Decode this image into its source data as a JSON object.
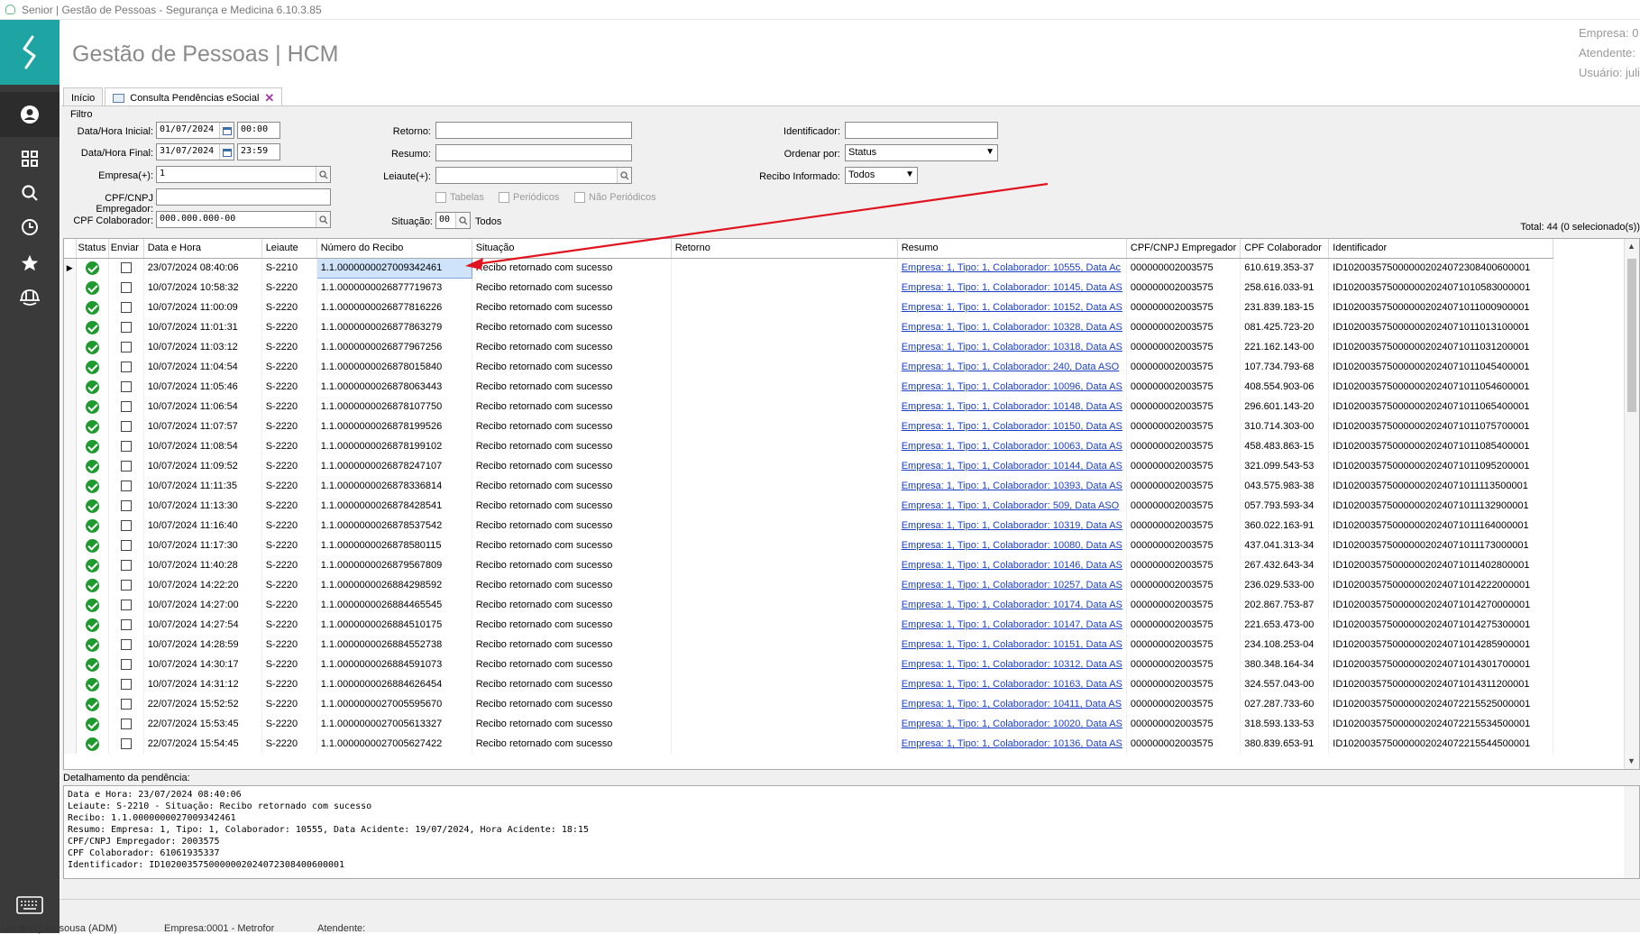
{
  "window": {
    "title": "Senior | Gestão de Pessoas - Segurança e Medicina 6.10.3.85"
  },
  "header": {
    "app_title": "Gestão de Pessoas | HCM",
    "empresa_label": "Empresa: 0",
    "atendente_label": "Atendente:",
    "usuario_label": "Usuário: juli"
  },
  "tabs": [
    {
      "label": "Início"
    },
    {
      "label": "Consulta Pendências eSocial"
    }
  ],
  "filter": {
    "section_label": "Filtro",
    "data_hora_inicial_label": "Data/Hora Inicial:",
    "data_inicial": "01/07/2024",
    "hora_inicial": "00:00",
    "data_hora_final_label": "Data/Hora Final:",
    "data_final": "31/07/2024",
    "hora_final": "23:59",
    "empresa_label": "Empresa(+):",
    "empresa_value": "1",
    "cpf_cnpj_empregador_label": "CPF/CNPJ Empregador:",
    "cpf_cnpj_empregador_value": "",
    "cpf_colaborador_label": "CPF Colaborador:",
    "cpf_colaborador_value": "000.000.000-00",
    "retorno_label": "Retorno:",
    "resumo_label": "Resumo:",
    "leiaute_label": "Leiaute(+):",
    "tabelas_label": "Tabelas",
    "periodicos_label": "Periódicos",
    "nao_periodicos_label": "Não Periódicos",
    "situacao_label": "Situação:",
    "situacao_value": "00",
    "situacao_desc": "Todos",
    "identificador_label": "Identificador:",
    "ordenar_por_label": "Ordenar por:",
    "ordenar_por_value": "Status",
    "recibo_informado_label": "Recibo Informado:",
    "recibo_informado_value": "Todos",
    "total_text": "Total: 44 (0 selecionado(s))"
  },
  "grid": {
    "columns": [
      "Status",
      "Enviar",
      "Data e Hora",
      "Leiaute",
      "Número do Recibo",
      "Situação",
      "Retorno",
      "Resumo",
      "CPF/CNPJ Empregador",
      "CPF Colaborador",
      "Identificador"
    ],
    "rows": [
      {
        "data": "23/07/2024 08:40:06",
        "leiaute": "S-2210",
        "recibo": "1.1.0000000027009342461",
        "situacao": "Recibo retornado com sucesso",
        "resumo": "Empresa: 1, Tipo: 1, Colaborador: 10555, Data Ac",
        "empregador": "000000002003575",
        "cpf": "610.619.353-37",
        "id": "ID1020035750000002024072308400600001"
      },
      {
        "data": "10/07/2024 10:58:32",
        "leiaute": "S-2220",
        "recibo": "1.1.0000000026877719673",
        "situacao": "Recibo retornado com sucesso",
        "resumo": "Empresa: 1, Tipo: 1, Colaborador: 10145, Data AS",
        "empregador": "000000002003575",
        "cpf": "258.616.033-91",
        "id": "ID1020035750000002024071010583000001"
      },
      {
        "data": "10/07/2024 11:00:09",
        "leiaute": "S-2220",
        "recibo": "1.1.0000000026877816226",
        "situacao": "Recibo retornado com sucesso",
        "resumo": "Empresa: 1, Tipo: 1, Colaborador: 10152, Data AS",
        "empregador": "000000002003575",
        "cpf": "231.839.183-15",
        "id": "ID1020035750000002024071011000900001"
      },
      {
        "data": "10/07/2024 11:01:31",
        "leiaute": "S-2220",
        "recibo": "1.1.0000000026877863279",
        "situacao": "Recibo retornado com sucesso",
        "resumo": "Empresa: 1, Tipo: 1, Colaborador: 10328, Data AS",
        "empregador": "000000002003575",
        "cpf": "081.425.723-20",
        "id": "ID1020035750000002024071011013100001"
      },
      {
        "data": "10/07/2024 11:03:12",
        "leiaute": "S-2220",
        "recibo": "1.1.0000000026877967256",
        "situacao": "Recibo retornado com sucesso",
        "resumo": "Empresa: 1, Tipo: 1, Colaborador: 10318, Data AS",
        "empregador": "000000002003575",
        "cpf": "221.162.143-00",
        "id": "ID1020035750000002024071011031200001"
      },
      {
        "data": "10/07/2024 11:04:54",
        "leiaute": "S-2220",
        "recibo": "1.1.0000000026878015840",
        "situacao": "Recibo retornado com sucesso",
        "resumo": "Empresa: 1, Tipo: 1, Colaborador: 240, Data ASO",
        "empregador": "000000002003575",
        "cpf": "107.734.793-68",
        "id": "ID1020035750000002024071011045400001"
      },
      {
        "data": "10/07/2024 11:05:46",
        "leiaute": "S-2220",
        "recibo": "1.1.0000000026878063443",
        "situacao": "Recibo retornado com sucesso",
        "resumo": "Empresa: 1, Tipo: 1, Colaborador: 10096, Data AS",
        "empregador": "000000002003575",
        "cpf": "408.554.903-06",
        "id": "ID1020035750000002024071011054600001"
      },
      {
        "data": "10/07/2024 11:06:54",
        "leiaute": "S-2220",
        "recibo": "1.1.0000000026878107750",
        "situacao": "Recibo retornado com sucesso",
        "resumo": "Empresa: 1, Tipo: 1, Colaborador: 10148, Data AS",
        "empregador": "000000002003575",
        "cpf": "296.601.143-20",
        "id": "ID1020035750000002024071011065400001"
      },
      {
        "data": "10/07/2024 11:07:57",
        "leiaute": "S-2220",
        "recibo": "1.1.0000000026878199526",
        "situacao": "Recibo retornado com sucesso",
        "resumo": "Empresa: 1, Tipo: 1, Colaborador: 10150, Data AS",
        "empregador": "000000002003575",
        "cpf": "310.714.303-00",
        "id": "ID1020035750000002024071011075700001"
      },
      {
        "data": "10/07/2024 11:08:54",
        "leiaute": "S-2220",
        "recibo": "1.1.0000000026878199102",
        "situacao": "Recibo retornado com sucesso",
        "resumo": "Empresa: 1, Tipo: 1, Colaborador: 10063, Data AS",
        "empregador": "000000002003575",
        "cpf": "458.483.863-15",
        "id": "ID1020035750000002024071011085400001"
      },
      {
        "data": "10/07/2024 11:09:52",
        "leiaute": "S-2220",
        "recibo": "1.1.0000000026878247107",
        "situacao": "Recibo retornado com sucesso",
        "resumo": "Empresa: 1, Tipo: 1, Colaborador: 10144, Data AS",
        "empregador": "000000002003575",
        "cpf": "321.099.543-53",
        "id": "ID1020035750000002024071011095200001"
      },
      {
        "data": "10/07/2024 11:11:35",
        "leiaute": "S-2220",
        "recibo": "1.1.0000000026878336814",
        "situacao": "Recibo retornado com sucesso",
        "resumo": "Empresa: 1, Tipo: 1, Colaborador: 10393, Data AS",
        "empregador": "000000002003575",
        "cpf": "043.575.983-38",
        "id": "ID1020035750000002024071011113500001"
      },
      {
        "data": "10/07/2024 11:13:30",
        "leiaute": "S-2220",
        "recibo": "1.1.0000000026878428541",
        "situacao": "Recibo retornado com sucesso",
        "resumo": "Empresa: 1, Tipo: 1, Colaborador: 509, Data ASO",
        "empregador": "000000002003575",
        "cpf": "057.793.593-34",
        "id": "ID1020035750000002024071011132900001"
      },
      {
        "data": "10/07/2024 11:16:40",
        "leiaute": "S-2220",
        "recibo": "1.1.0000000026878537542",
        "situacao": "Recibo retornado com sucesso",
        "resumo": "Empresa: 1, Tipo: 1, Colaborador: 10319, Data AS",
        "empregador": "000000002003575",
        "cpf": "360.022.163-91",
        "id": "ID1020035750000002024071011164000001"
      },
      {
        "data": "10/07/2024 11:17:30",
        "leiaute": "S-2220",
        "recibo": "1.1.0000000026878580115",
        "situacao": "Recibo retornado com sucesso",
        "resumo": "Empresa: 1, Tipo: 1, Colaborador: 10080, Data AS",
        "empregador": "000000002003575",
        "cpf": "437.041.313-34",
        "id": "ID1020035750000002024071011173000001"
      },
      {
        "data": "10/07/2024 11:40:28",
        "leiaute": "S-2220",
        "recibo": "1.1.0000000026879567809",
        "situacao": "Recibo retornado com sucesso",
        "resumo": "Empresa: 1, Tipo: 1, Colaborador: 10146, Data AS",
        "empregador": "000000002003575",
        "cpf": "267.432.643-34",
        "id": "ID1020035750000002024071011402800001"
      },
      {
        "data": "10/07/2024 14:22:20",
        "leiaute": "S-2220",
        "recibo": "1.1.0000000026884298592",
        "situacao": "Recibo retornado com sucesso",
        "resumo": "Empresa: 1, Tipo: 1, Colaborador: 10257, Data AS",
        "empregador": "000000002003575",
        "cpf": "236.029.533-00",
        "id": "ID1020035750000002024071014222000001"
      },
      {
        "data": "10/07/2024 14:27:00",
        "leiaute": "S-2220",
        "recibo": "1.1.0000000026884465545",
        "situacao": "Recibo retornado com sucesso",
        "resumo": "Empresa: 1, Tipo: 1, Colaborador: 10174, Data AS",
        "empregador": "000000002003575",
        "cpf": "202.867.753-87",
        "id": "ID1020035750000002024071014270000001"
      },
      {
        "data": "10/07/2024 14:27:54",
        "leiaute": "S-2220",
        "recibo": "1.1.0000000026884510175",
        "situacao": "Recibo retornado com sucesso",
        "resumo": "Empresa: 1, Tipo: 1, Colaborador: 10147, Data AS",
        "empregador": "000000002003575",
        "cpf": "221.653.473-00",
        "id": "ID1020035750000002024071014275300001"
      },
      {
        "data": "10/07/2024 14:28:59",
        "leiaute": "S-2220",
        "recibo": "1.1.0000000026884552738",
        "situacao": "Recibo retornado com sucesso",
        "resumo": "Empresa: 1, Tipo: 1, Colaborador: 10151, Data AS",
        "empregador": "000000002003575",
        "cpf": "234.108.253-04",
        "id": "ID1020035750000002024071014285900001"
      },
      {
        "data": "10/07/2024 14:30:17",
        "leiaute": "S-2220",
        "recibo": "1.1.0000000026884591073",
        "situacao": "Recibo retornado com sucesso",
        "resumo": "Empresa: 1, Tipo: 1, Colaborador: 10312, Data AS",
        "empregador": "000000002003575",
        "cpf": "380.348.164-34",
        "id": "ID1020035750000002024071014301700001"
      },
      {
        "data": "10/07/2024 14:31:12",
        "leiaute": "S-2220",
        "recibo": "1.1.0000000026884626454",
        "situacao": "Recibo retornado com sucesso",
        "resumo": "Empresa: 1, Tipo: 1, Colaborador: 10163, Data AS",
        "empregador": "000000002003575",
        "cpf": "324.557.043-00",
        "id": "ID1020035750000002024071014311200001"
      },
      {
        "data": "22/07/2024 15:52:52",
        "leiaute": "S-2220",
        "recibo": "1.1.0000000027005595670",
        "situacao": "Recibo retornado com sucesso",
        "resumo": "Empresa: 1, Tipo: 1, Colaborador: 10411, Data AS",
        "empregador": "000000002003575",
        "cpf": "027.287.733-60",
        "id": "ID1020035750000002024072215525000001"
      },
      {
        "data": "22/07/2024 15:53:45",
        "leiaute": "S-2220",
        "recibo": "1.1.0000000027005613327",
        "situacao": "Recibo retornado com sucesso",
        "resumo": "Empresa: 1, Tipo: 1, Colaborador: 10020, Data AS",
        "empregador": "000000002003575",
        "cpf": "318.593.133-53",
        "id": "ID1020035750000002024072215534500001"
      },
      {
        "data": "22/07/2024 15:54:45",
        "leiaute": "S-2220",
        "recibo": "1.1.0000000027005627422",
        "situacao": "Recibo retornado com sucesso",
        "resumo": "Empresa: 1, Tipo: 1, Colaborador: 10136, Data AS",
        "empregador": "000000002003575",
        "cpf": "380.839.653-91",
        "id": "ID1020035750000002024072215544500001"
      }
    ]
  },
  "detail": {
    "label": "Detalhamento da pendência:",
    "lines": [
      "Data e Hora: 23/07/2024 08:40:06",
      "Leiaute: S-2210 - Situação: Recibo retornado com sucesso",
      "Recibo: 1.1.0000000027009342461",
      "Resumo: Empresa: 1, Tipo: 1, Colaborador: 10555, Data Acidente: 19/07/2024, Hora Acidente: 18:15",
      "CPF/CNPJ Empregador: 2003575",
      "CPF Colaborador: 61061935337",
      "Identificador: ID1020035750000002024072308400600001"
    ]
  },
  "statusbar": {
    "usuario": "Usuário:julia.sousa (ADM)",
    "empresa": "Empresa:0001 - Metrofor",
    "atendente": "Atendente:"
  },
  "colors": {
    "accent": "#1fa4a4",
    "sidebar": "#3a3a3a",
    "link": "#1a3fc7",
    "ok": "#1f9a2e",
    "arrow": "#e0141e"
  },
  "icons": [
    "senior-logo-icon",
    "user-icon",
    "grid-icon",
    "search-icon",
    "clock-icon",
    "star-icon",
    "helmet-icon",
    "keyboard-icon",
    "calendar-icon",
    "lookup-icon",
    "check-circle-icon"
  ]
}
